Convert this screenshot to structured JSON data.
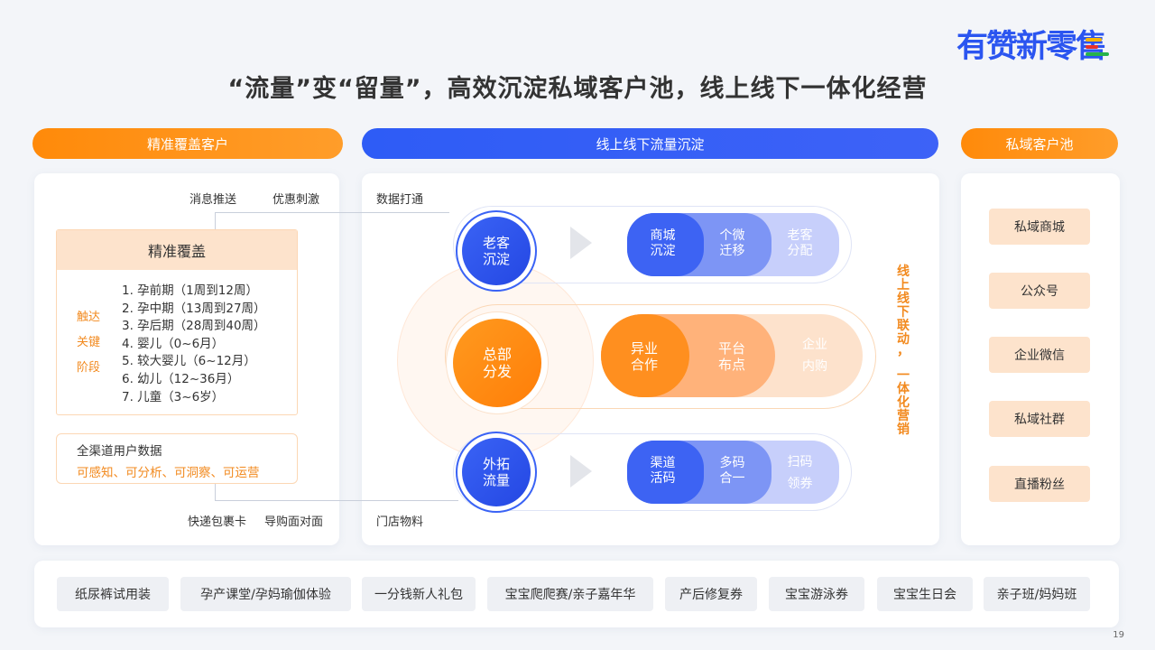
{
  "logo": {
    "text": "有赞新零售"
  },
  "title": "“流量”变“留量”，高效沉淀私域客户池，线上线下一体化经营",
  "headers": {
    "left": "精准覆盖客户",
    "middle": "线上线下流量沉淀",
    "right": "私域客户池"
  },
  "left_panel": {
    "top_labels": [
      "消息推送",
      "优惠刺激"
    ],
    "bottom_labels": [
      "快递包裹卡",
      "导购面对面"
    ],
    "cover_box": {
      "title": "精准覆盖",
      "tags": [
        "触达",
        "关键",
        "阶段"
      ],
      "stages": [
        "1.  孕前期（1周到12周）",
        "2.  孕中期（13周到27周）",
        "3.  孕后期（28周到40周）",
        "4.  婴儿（0~6月）",
        "5.  较大婴儿（6~12月）",
        "6.  幼儿（12~36月）",
        "7.  儿童（3~6岁）"
      ]
    },
    "data_box": {
      "title": "全渠道用户数据",
      "subtitle": "可感知、可分析、可洞察、可运营"
    }
  },
  "middle_panel": {
    "label_top": "数据打通",
    "label_bottom": "门店物料",
    "vertical_text": "线上线下联动，一体化营销",
    "rows": [
      {
        "circle": "老客\n沉淀",
        "segments": [
          "商城\n沉淀",
          "个微\n迁移",
          "老客\n分配"
        ]
      },
      {
        "circle": "总部\n分发",
        "segments": [
          "异业\n合作",
          "平台\n布点",
          "企业\n内购"
        ]
      },
      {
        "circle": "外拓\n流量",
        "segments": [
          "渠道\n活码",
          "多码\n合一",
          "扫码\n领券"
        ]
      }
    ]
  },
  "right_panel": {
    "items": [
      "私域商城",
      "公众号",
      "企业微信",
      "私域社群",
      "直播粉丝"
    ]
  },
  "activities": [
    "纸尿裤试用装",
    "孕产课堂/孕妈瑜伽体验",
    "一分钱新人礼包",
    "宝宝爬爬赛/亲子嘉年华",
    "产后修复券",
    "宝宝游泳券",
    "宝宝生日会",
    "亲子班/妈妈班"
  ],
  "page_number": "19",
  "colors": {
    "brand_blue": "#2b55f0",
    "accent_orange": "#ff8a0a",
    "peach": "#fde3cc"
  }
}
